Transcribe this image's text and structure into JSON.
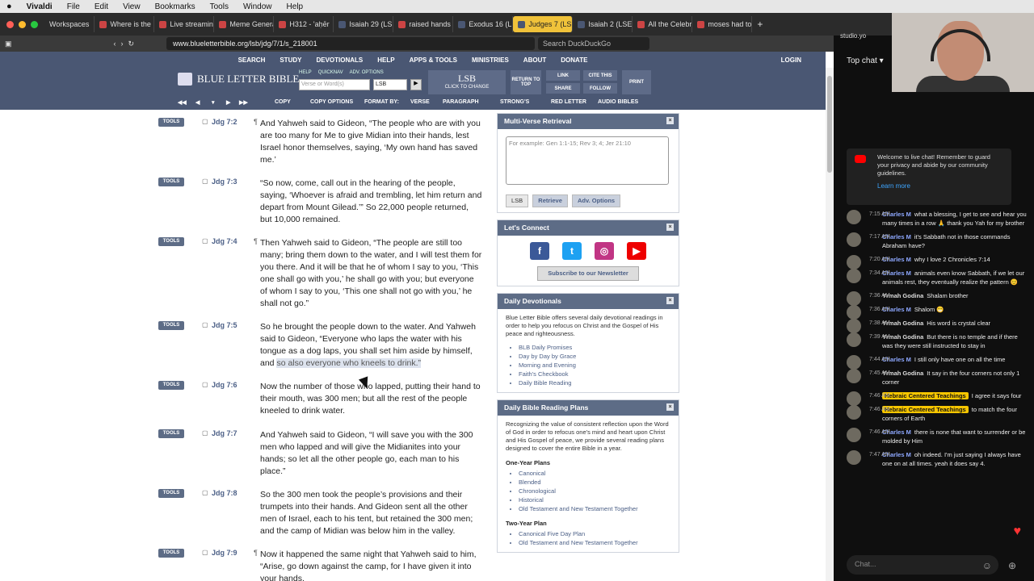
{
  "menubar": {
    "app": "Vivaldi",
    "items": [
      "File",
      "Edit",
      "View",
      "Bookmarks",
      "Tools",
      "Window",
      "Help"
    ]
  },
  "tabs": [
    {
      "label": "Workspaces"
    },
    {
      "label": "Where is the"
    },
    {
      "label": "Live streamin"
    },
    {
      "label": "Meme Genera"
    },
    {
      "label": "H312 - 'aḥēr"
    },
    {
      "label": "Isaiah 29 (LS"
    },
    {
      "label": "raised hands"
    },
    {
      "label": "Exodus 16 (L"
    },
    {
      "label": "Judges 7 (LS"
    },
    {
      "label": "Isaiah 2 (LSE"
    },
    {
      "label": "All the Celebr"
    },
    {
      "label": "moses had to"
    }
  ],
  "address": {
    "url": "www.blueletterbible.org/lsb/jdg/7/1/s_218001",
    "search_placeholder": "Search DuckDuckGo"
  },
  "nav": {
    "items": [
      "SEARCH",
      "STUDY",
      "DEVOTIONALS",
      "HELP",
      "APPS & TOOLS",
      "MINISTRIES",
      "ABOUT",
      "DONATE"
    ],
    "login": "LOGIN"
  },
  "header": {
    "logo": "BLUE LETTER BIBLE",
    "mini_links": [
      "HELP",
      "QUICKNAV",
      "ADV. OPTIONS"
    ],
    "verse_placeholder": "Verse or Word(s)",
    "version": "LSB",
    "version_big": "LSB",
    "version_small": "CLICK TO CHANGE",
    "return": "RETURN TO TOP",
    "link": "LINK",
    "share": "SHARE",
    "cite": "CITE THIS",
    "follow": "FOLLOW",
    "print": "PRINT"
  },
  "toolbar": {
    "copy": "COPY",
    "copy_options": "COPY OPTIONS",
    "format": "FORMAT BY:",
    "verse": "VERSE",
    "paragraph": "PARAGRAPH",
    "strongs": "STRONG'S",
    "red_letter": "RED LETTER",
    "audio": "AUDIO BIBLES"
  },
  "verses": [
    {
      "ref": "Jdg 7:2",
      "tools": "TOOLS",
      "pil": "¶",
      "text": "And Yahweh said to Gideon, “The people who are with you are too many for Me to give Midian into their hands, lest Israel honor themselves, saying, ‘My own hand has saved me.’"
    },
    {
      "ref": "Jdg 7:3",
      "tools": "TOOLS",
      "pil": "",
      "text": "“So now, come, call out in the hearing of the people, saying, ‘Whoever is afraid and trembling, let him return and depart from Mount Gilead.’” So 22,000 people returned, but 10,000 remained."
    },
    {
      "ref": "Jdg 7:4",
      "tools": "TOOLS",
      "pil": "¶",
      "text": "Then Yahweh said to Gideon, “The people are still too many; bring them down to the water, and I will test them for you there. And it will be that he of whom I say to you, ‘This one shall go with you,’ he shall go with you; but everyone of whom I say to you, ‘This one shall not go with you,’ he shall not go.”"
    },
    {
      "ref": "Jdg 7:5",
      "tools": "TOOLS",
      "pil": "",
      "text": "So he brought the people down to the water. And Yahweh said to Gideon, “Everyone who laps the water with his tongue as a dog laps, you shall set him aside by himself, and",
      "highlight": "so also everyone who kneels to drink.”"
    },
    {
      "ref": "Jdg 7:6",
      "tools": "TOOLS",
      "pil": "",
      "text": "Now the number of those who lapped, putting their hand to their mouth, was 300 men; but all the rest of the people kneeled to drink water."
    },
    {
      "ref": "Jdg 7:7",
      "tools": "TOOLS",
      "pil": "",
      "text": "And Yahweh said to Gideon, “I will save you with the 300 men who lapped and will give the Midianites into your hands; so let all the other people go, each man to his place.”"
    },
    {
      "ref": "Jdg 7:8",
      "tools": "TOOLS",
      "pil": "",
      "text": "So the 300 men took the people’s provisions and their trumpets into their hands. And Gideon sent all the other men of Israel, each to his tent, but retained the 300 men; and the camp of Midian was below him in the valley."
    },
    {
      "ref": "Jdg 7:9",
      "tools": "TOOLS",
      "pil": "¶",
      "text": "Now it happened the same night that Yahweh said to him, “Arise, go down against the camp, for I have given it into your hands."
    }
  ],
  "sidebar": {
    "mvr_title": "Multi-Verse Retrieval",
    "mvr_placeholder": "For example: Gen 1:1-15; Rev 3; 4; Jer 21:10",
    "mvr_version": "LSB",
    "retrieve": "Retrieve",
    "adv": "Adv. Options",
    "connect_title": "Let's Connect",
    "newsletter": "Subscribe to our Newsletter",
    "dev_title": "Daily Devotionals",
    "dev_text": "Blue Letter Bible offers several daily devotional readings in order to help you refocus on Christ and the Gospel of His peace and righteousness.",
    "dev_links": [
      "BLB Daily Promises",
      "Day by Day by Grace",
      "Morning and Evening",
      "Faith's Checkbook",
      "Daily Bible Reading"
    ],
    "plans_title": "Daily Bible Reading Plans",
    "plans_text": "Recognizing the value of consistent reflection upon the Word of God in order to refocus one's mind and heart upon Christ and His Gospel of peace, we provide several reading plans designed to cover the entire Bible in a year.",
    "one_year": "One-Year Plans",
    "one_year_links": [
      "Canonical",
      "Blended",
      "Chronological",
      "Historical",
      "Old Testament and New Testament Together"
    ],
    "two_year": "Two-Year Plan",
    "two_year_links": [
      "Canonical Five Day Plan",
      "Old Testament and New Testament Together"
    ]
  },
  "chat": {
    "url": "studio.yo",
    "top": "Top chat",
    "welcome": "Welcome to live chat! Remember to guard your privacy and abide by our community guidelines.",
    "learn": "Learn more",
    "placeholder": "Chat...",
    "messages": [
      {
        "time": "7:15 AM",
        "author": "Charles M",
        "kind": "mod",
        "text": "what a blessing, I get to see and hear you many times in a row 🙏 thank you Yah for my brother"
      },
      {
        "time": "7:17 AM",
        "author": "Charles M",
        "kind": "mod",
        "text": "it's Sabbath not in those commands Abraham have?"
      },
      {
        "time": "7:20 AM",
        "author": "Charles M",
        "kind": "mod",
        "text": "why I love 2 Chronicles 7:14"
      },
      {
        "time": "7:34 AM",
        "author": "Charles M",
        "kind": "mod",
        "text": "animals even know Sabbath, if we let our animals rest, they eventually realize the pattern 😊"
      },
      {
        "time": "7:36 AM",
        "author": "Yrmah Godina",
        "kind": "plain",
        "text": "Shalam brother"
      },
      {
        "time": "7:36 AM",
        "author": "Charles M",
        "kind": "mod",
        "text": "Shalom 😁"
      },
      {
        "time": "7:38 AM",
        "author": "Yrmah Godina",
        "kind": "plain",
        "text": "His word is crystal clear"
      },
      {
        "time": "7:39 AM",
        "author": "Yrmah Godina",
        "kind": "plain",
        "text": "But there is no temple and if there was they were still instructed to stay in"
      },
      {
        "time": "7:44 AM",
        "author": "Charles M",
        "kind": "mod",
        "text": "I still only have one on all the time"
      },
      {
        "time": "7:45 AM",
        "author": "Yrmah Godina",
        "kind": "plain",
        "text": "It say in the four corners not only 1 corner"
      },
      {
        "time": "7:46 AM",
        "author": "Hebraic Centered Teachings",
        "kind": "member",
        "text": "I agree it says four"
      },
      {
        "time": "7:46 AM",
        "author": "Hebraic Centered Teachings",
        "kind": "member",
        "text": "to match the four corners of Earth"
      },
      {
        "time": "7:46 AM",
        "author": "Charles M",
        "kind": "mod",
        "text": "there is none that want to surrender or be molded by Him"
      },
      {
        "time": "7:47 AM",
        "author": "Charles M",
        "kind": "mod",
        "text": "oh indeed. I'm just saying I always have one on at all times. yeah it does say 4."
      }
    ]
  }
}
